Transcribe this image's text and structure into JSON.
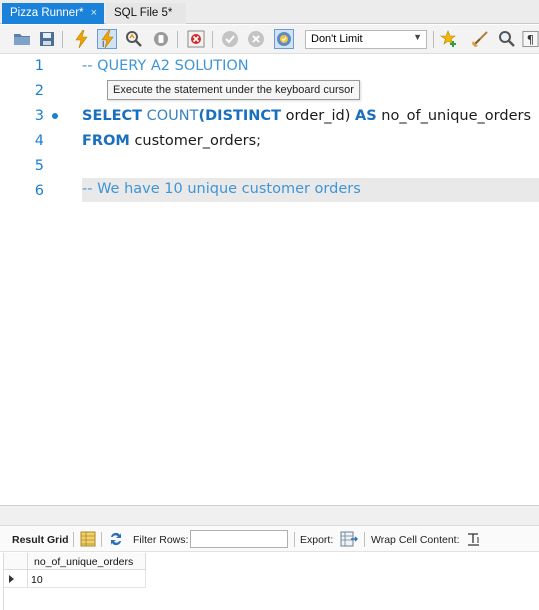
{
  "tabs": [
    {
      "label": "Pizza Runner*",
      "active": true,
      "close": "×"
    },
    {
      "label": "SQL File 5*",
      "active": false
    }
  ],
  "toolbar": {
    "limit_value": "Don't Limit",
    "icons": [
      "open-folder-icon",
      "save-icon",
      "execute-lightning-icon",
      "execute-cursor-lightning-icon",
      "explain-magnifier-icon",
      "stop-icon",
      "toggle-continue-on-error-icon",
      "commit-icon",
      "rollback-icon",
      "autocommit-icon",
      "limit-dropdown",
      "add-snippet-star-icon",
      "beautify-broom-icon",
      "find-magnifier-icon",
      "invisible-chars-icon"
    ]
  },
  "editor": {
    "line_numbers": [
      "1",
      "2",
      "3",
      "4",
      "5",
      "6"
    ],
    "tooltip": "Execute the statement under the keyboard cursor",
    "lines": {
      "l1": "-- QUERY A2 SOLUTION",
      "l3_select": "SELECT",
      "l3_count": "COUNT",
      "l3_paren_open": "(",
      "l3_distinct": "DISTINCT",
      "l3_rest": " order_id)",
      "l3_as": "AS",
      "l3_alias": "no_of_unique_orders",
      "l4_from": "FROM",
      "l4_table": "customer_orders;",
      "l6": "-- We have 10 unique customer orders"
    }
  },
  "result_toolbar": {
    "result_grid": "Result Grid",
    "filter_rows": "Filter Rows:",
    "filter_value": "",
    "export": "Export:",
    "wrap_cell": "Wrap Cell Content:"
  },
  "grid": {
    "columns": [
      "no_of_unique_orders"
    ],
    "rows": [
      [
        "10"
      ]
    ]
  },
  "colors": {
    "active_tab": "#1a82d8",
    "keyword": "#1a6fbf",
    "comment": "#3f95d6",
    "line_number": "#1b7fd2"
  }
}
